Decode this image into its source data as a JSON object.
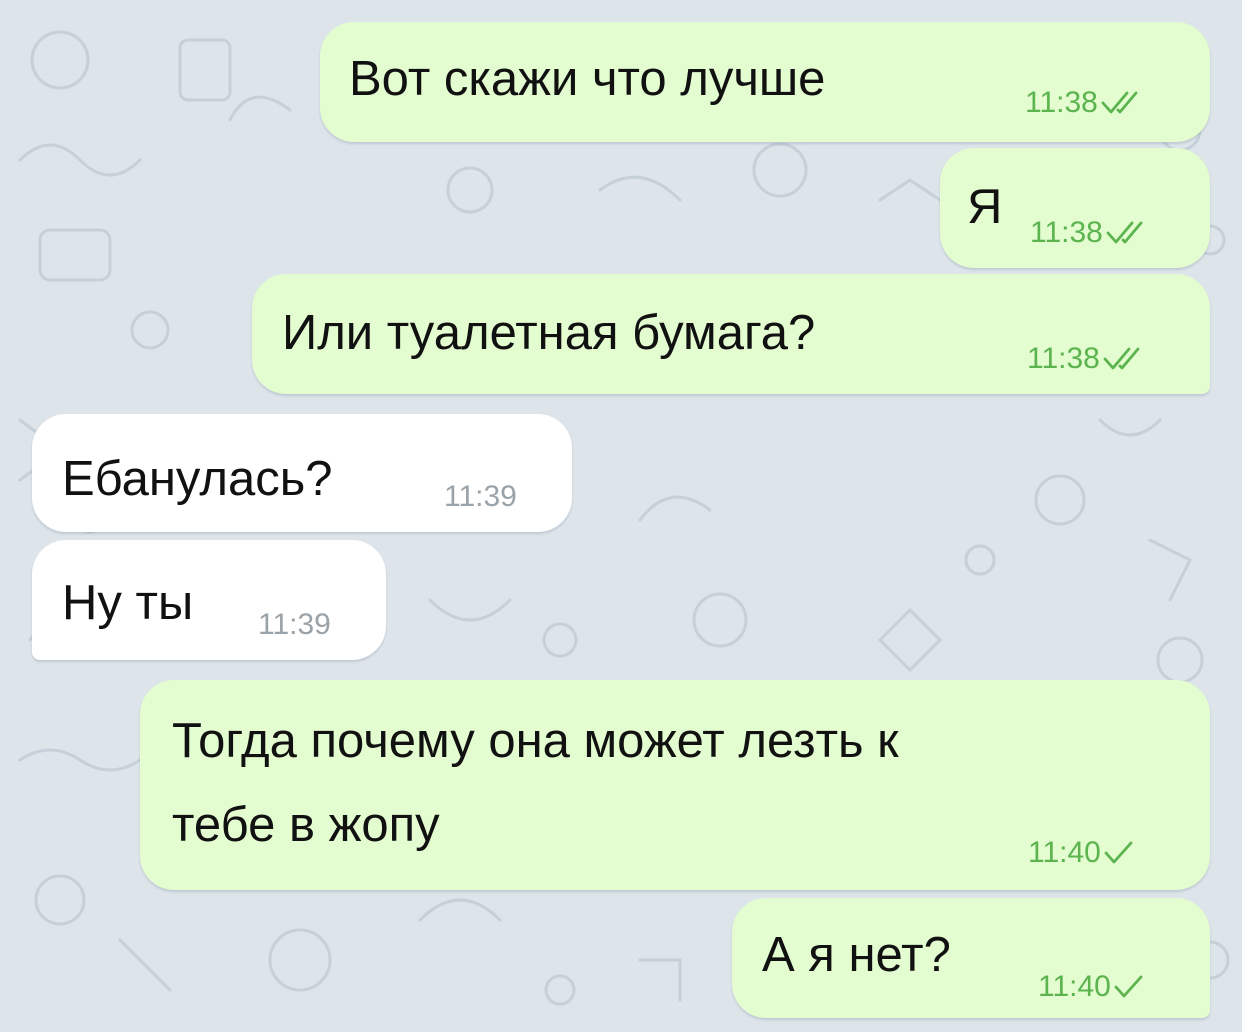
{
  "chat": {
    "messages": [
      {
        "direction": "out",
        "text": "Вот скажи что лучше",
        "time": "11:38",
        "status": "read"
      },
      {
        "direction": "out",
        "text": "Я",
        "time": "11:38",
        "status": "read"
      },
      {
        "direction": "out",
        "text": "Или туалетная бумага?",
        "time": "11:38",
        "status": "read"
      },
      {
        "direction": "in",
        "text": "Ебанулась?",
        "time": "11:39"
      },
      {
        "direction": "in",
        "text": "Ну ты",
        "time": "11:39"
      },
      {
        "direction": "out",
        "text_line1": "Тогда почему она может лезть к",
        "text_line2": "тебе в жопу",
        "time": "11:40",
        "status": "sent"
      },
      {
        "direction": "out",
        "text": "А я нет?",
        "time": "11:40",
        "status": "sent"
      }
    ]
  },
  "theme": {
    "background": "#dde4ea",
    "outgoing_bubble": "#e3fcd0",
    "incoming_bubble": "#ffffff",
    "outgoing_time_color": "#5bb44e",
    "incoming_time_color": "#9aa3a9",
    "check_icon": "check-icon",
    "double_check_icon": "double-check-icon"
  }
}
